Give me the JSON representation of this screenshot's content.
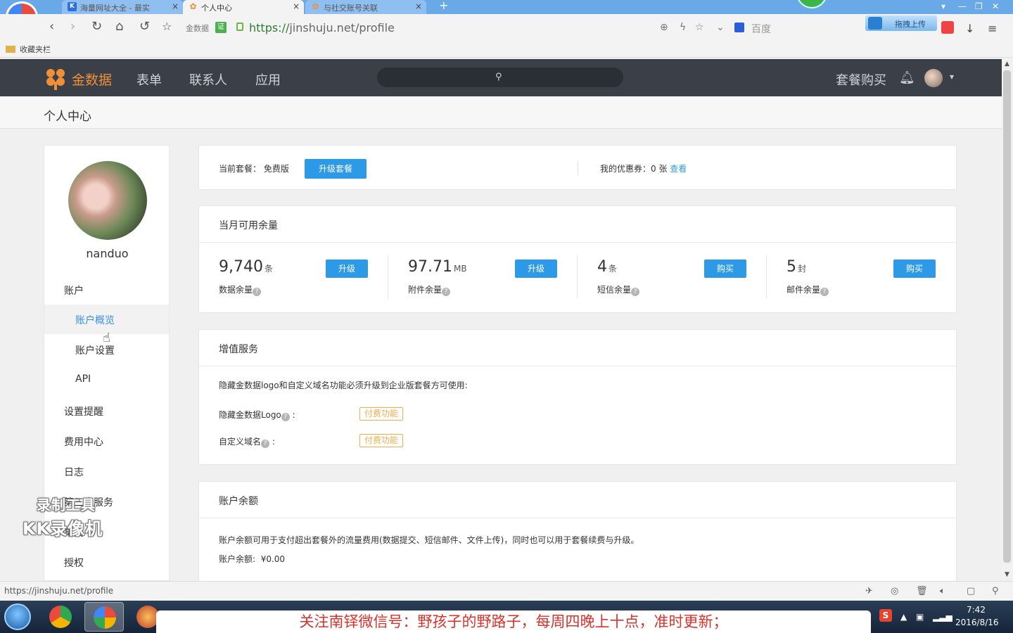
{
  "browser": {
    "tabs": [
      {
        "label": "海量网址大全 - 最实",
        "icon": "K",
        "color": "#2b6fd8"
      },
      {
        "label": "个人中心",
        "icon": "✿",
        "color": "#f08f3a"
      },
      {
        "label": "与社交账号关联",
        "icon": "✿",
        "color": "#f08f3a"
      }
    ],
    "address": {
      "prefix_tag": "金数据",
      "url_prefix": "https://",
      "url_host": "jinshuju.net",
      "url_path": "/profile"
    },
    "search_engine": "百度",
    "upload_button": "拖拽上传",
    "bookmarks_label": "收藏夹栏"
  },
  "site": {
    "logo_text": "金数据",
    "nav": [
      "表单",
      "联系人",
      "应用"
    ],
    "buy_link": "套餐购买"
  },
  "page": {
    "title": "个人中心"
  },
  "sidebar": {
    "username": "nanduo",
    "section_account": "账户",
    "sub_items": [
      "账户概览",
      "账户设置",
      "API"
    ],
    "items": [
      "设置提醒",
      "费用中心",
      "日志",
      "第三方服务",
      "集成",
      "授权"
    ]
  },
  "plan": {
    "label": "当前套餐： 免费版",
    "upgrade_button": "升级套餐",
    "coupon_label": "我的优惠券：0 张",
    "coupon_link": "查看"
  },
  "quota": {
    "title": "当月可用余量",
    "cells": [
      {
        "number": "9,740",
        "unit": "条",
        "label": "数据余量",
        "button": "升级"
      },
      {
        "number": "97.71",
        "unit": "MB",
        "label": "附件余量",
        "button": "升级"
      },
      {
        "number": "4",
        "unit": "条",
        "label": "短信余量",
        "button": "购买"
      },
      {
        "number": "5",
        "unit": "封",
        "label": "邮件余量",
        "button": "购买"
      }
    ]
  },
  "value_added": {
    "title": "增值服务",
    "description": "隐藏金数据logo和自定义域名功能必须升级到企业版套餐方可使用:",
    "rows": [
      {
        "label": "隐藏金数据Logo",
        "tag": "付费功能"
      },
      {
        "label": "自定义域名",
        "tag": "付费功能"
      }
    ]
  },
  "balance": {
    "title": "账户余额",
    "description": "账户余额可用于支付超出套餐外的流量费用(数据提交、短信邮件、文件上传)，同时也可以用于套餐续费与升级。",
    "amount_label": "账户余额:",
    "amount_value": "¥0.00"
  },
  "statusbar": {
    "url": "https://jinshuju.net/profile"
  },
  "taskbar": {
    "notice": "关注南铎微信号：野孩子的野路子，每周四晚上十点，准时更新；",
    "time": "7:42",
    "date": "2016/8/16"
  },
  "watermark": {
    "line1": "录制工具",
    "line2": "KK录像机"
  }
}
